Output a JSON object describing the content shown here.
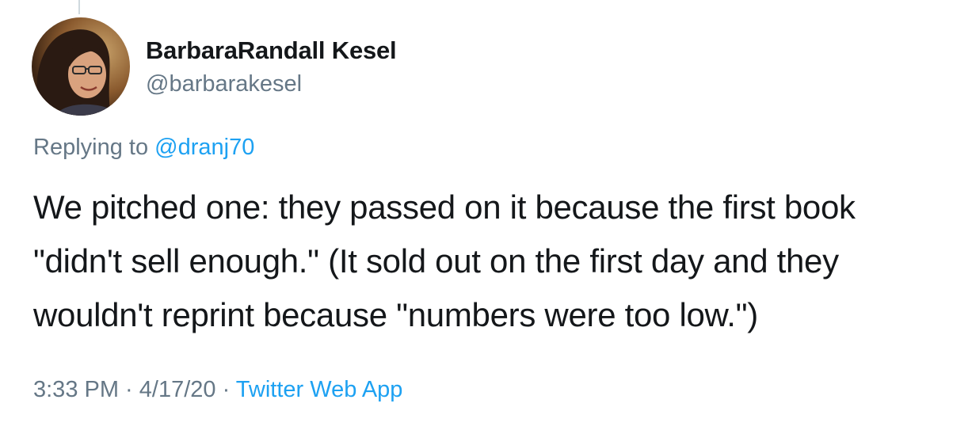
{
  "user": {
    "display_name": "BarbaraRandall Kesel",
    "handle": "@barbarakesel"
  },
  "reply": {
    "prefix": "Replying to ",
    "mention": "@dranj70"
  },
  "tweet": {
    "lines": [
      "We pitched one: they passed on it because the first book",
      "\"didn't sell enough.\" (It sold out on the first day and they",
      "wouldn't reprint because \"numbers were too low.\")"
    ]
  },
  "meta": {
    "time": "3:33 PM",
    "separator_1": " · ",
    "date": "4/17/20",
    "separator_2": " · ",
    "source": "Twitter Web App"
  },
  "colors": {
    "text": "#14171a",
    "secondary": "#657786",
    "link": "#1da1f2"
  }
}
